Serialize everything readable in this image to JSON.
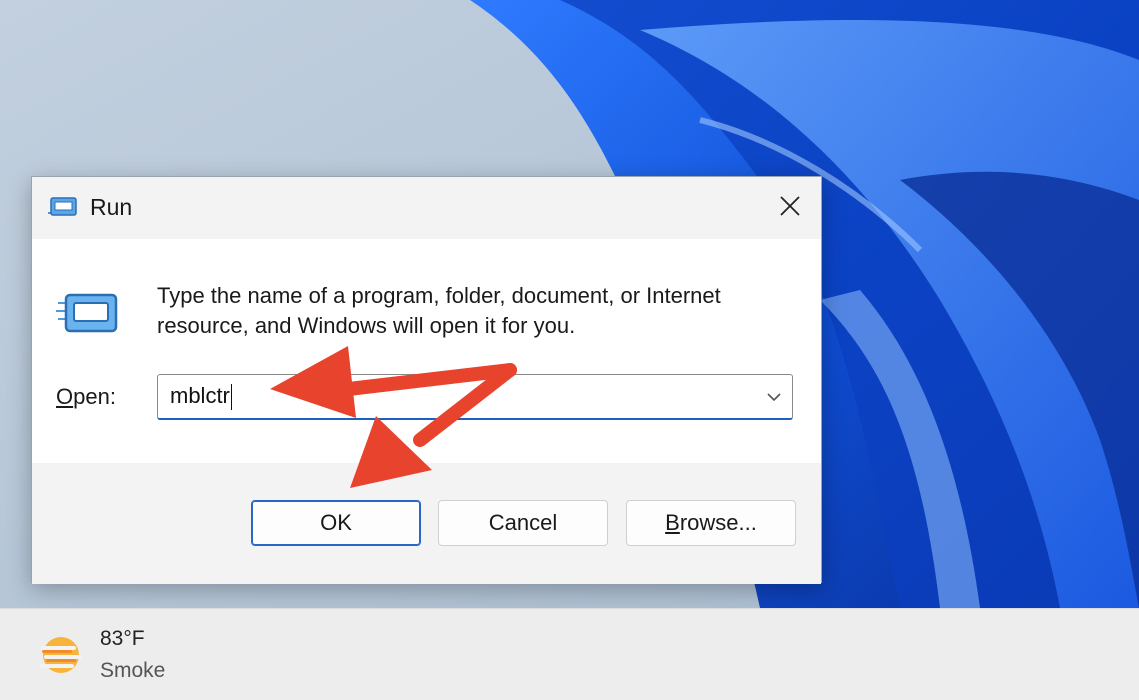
{
  "dialog": {
    "title": "Run",
    "description": "Type the name of a program, folder, document, or Internet resource, and Windows will open it for you.",
    "open_label_underlined": "O",
    "open_label_rest": "pen:",
    "input_value": "mblctr",
    "buttons": {
      "ok": "OK",
      "cancel": "Cancel",
      "browse_underlined": "B",
      "browse_rest": "rowse..."
    }
  },
  "taskbar": {
    "weather": {
      "temperature": "83°F",
      "condition": "Smoke"
    }
  },
  "colors": {
    "annotation_arrow": "#e8432d",
    "focus_accent": "#1f5fbf",
    "wallpaper_blue": "#1a56e0"
  },
  "icons": {
    "app": "run-app-icon",
    "close": "close-icon",
    "dropdown": "chevron-down-icon",
    "weather": "smoke-weather-icon"
  }
}
